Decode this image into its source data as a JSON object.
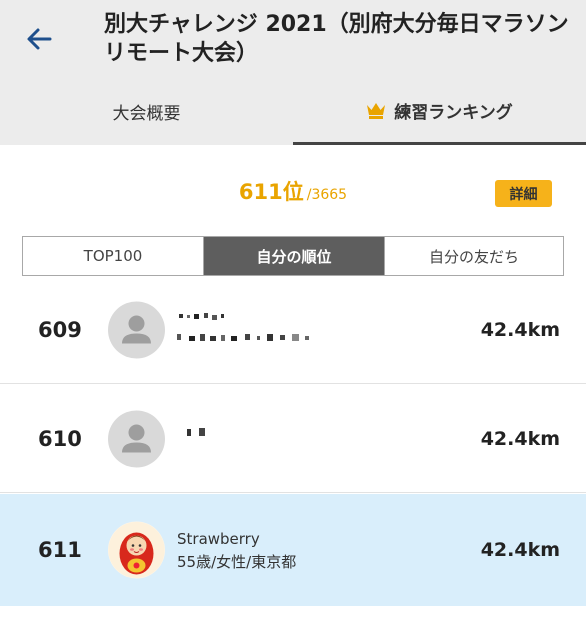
{
  "header": {
    "title": "別大チャレンジ 2021（別府大分毎日マラソンリモート大会）",
    "back_icon": "arrow-left-icon"
  },
  "tabs": [
    {
      "label": "大会概要",
      "active": false
    },
    {
      "label": "練習ランキング",
      "active": true,
      "icon": "crown-icon"
    }
  ],
  "rank": {
    "position": "611位",
    "total": "/3665",
    "detail_label": "詳細"
  },
  "segments": [
    {
      "label": "TOP100",
      "active": false
    },
    {
      "label": "自分の順位",
      "active": true
    },
    {
      "label": "自分の友だち",
      "active": false
    }
  ],
  "rows": [
    {
      "rank": "609",
      "name": "",
      "profile": "",
      "distance": "42.4km",
      "avatar": "default-user-icon",
      "highlighted": false
    },
    {
      "rank": "610",
      "name": "",
      "profile": "",
      "distance": "42.4km",
      "avatar": "default-user-icon",
      "highlighted": false
    },
    {
      "rank": "611",
      "name": "Strawberry",
      "profile": "55歳/女性/東京都",
      "distance": "42.4km",
      "avatar": "matryoshka-avatar",
      "highlighted": true
    }
  ],
  "colors": {
    "accent": "#e9a400",
    "detail_button": "#f6b21a",
    "active_segment": "#5e5e5e",
    "highlight_row": "#d9eefb",
    "back_arrow": "#1e4f8c"
  }
}
